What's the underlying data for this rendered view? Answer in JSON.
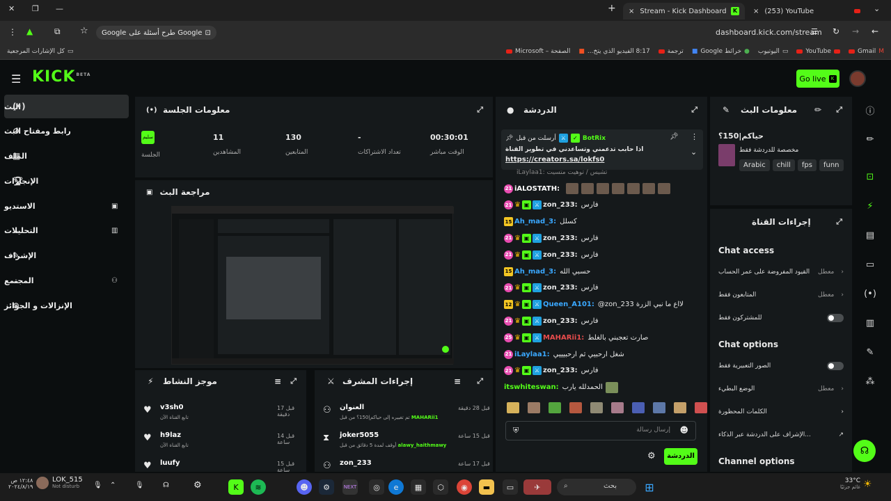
{
  "browser": {
    "tabs": [
      {
        "title": "Stream - Kick Dashboard",
        "close": "×"
      },
      {
        "title": "(253) YouTube",
        "close": "×"
      }
    ],
    "new_tab": "+",
    "url": "dashboard.kick.com/stream",
    "google_prompt": "طرح أسئلة على Google",
    "all_bookmarks": "كل الإشارات المرجعية",
    "bookmarks": [
      "Gmail",
      "YouTube",
      "اليوتيوب",
      "خرائط Google",
      "ترجمة",
      "8:17 الفيديو الذي يتخ...",
      "الصفحة – Microsoft"
    ]
  },
  "header": {
    "logo": "KICK",
    "beta": "BETA",
    "go_live": "Go live"
  },
  "nav": [
    {
      "label": "البث"
    },
    {
      "label": "رابط ومفتاح البث"
    },
    {
      "label": "الملف"
    },
    {
      "label": "الإنجازات"
    },
    {
      "label": "الاستديو"
    },
    {
      "label": "التحليلات"
    },
    {
      "label": "الإشراف"
    },
    {
      "label": "المجتمع"
    },
    {
      "label": "الإنزالات و الجوائز"
    }
  ],
  "session": {
    "title": "معلومات الجلسة",
    "badge": "سليم",
    "badge_label": "الجلسة",
    "stats": [
      {
        "value": "11",
        "label": "المشاهدين"
      },
      {
        "value": "130",
        "label": "المتابعين"
      },
      {
        "value": "-",
        "label": "تعداد الاشتراكات"
      },
      {
        "value": "00:30:01",
        "label": "الوقت مباشر"
      }
    ]
  },
  "preview": {
    "title": "مراجعة البث"
  },
  "activity": {
    "title": "موجز النشاط",
    "items": [
      {
        "name": "v3sh0",
        "sub": "تابع القناة الآن",
        "time": "قبل 17 دقيقة"
      },
      {
        "name": "h9laz",
        "sub": "تابع القناة الآن",
        "time": "قبل 14 ساعة"
      },
      {
        "name": "luufy",
        "sub": "",
        "time": "قبل 15 ساعة"
      }
    ]
  },
  "modlog": {
    "title": "إجراءات المشرف",
    "items": [
      {
        "name": "العنوان",
        "sub": "تم تغييره إلى حياكم|150؟ من قبل",
        "actor": "MAHARii1",
        "time": "قبل 28 دقيقة"
      },
      {
        "name": "joker5055",
        "sub": "أوقف لمدة 5 دقائق من قبل",
        "actor": "alawy_haithmawy",
        "time": "قبل 15 ساعة"
      },
      {
        "name": "zon_233",
        "sub": "",
        "actor": "",
        "time": "قبل 17 ساعة"
      }
    ]
  },
  "chat": {
    "title": "الدردشة",
    "pinned": {
      "by_label": "أرسلت من قبل",
      "by": "BotRix",
      "text": "اذا حابب تدعمني وتساعدني في تطوير القناة",
      "link": "https://creators.sa/lokfs0"
    },
    "partial_msg": "iLaylaa1: تشيس / توهيت متسيت",
    "messages": [
      {
        "lvl": "21",
        "user": "iALOSTATH:",
        "text": "",
        "color": "#ffffff",
        "emotes": true
      },
      {
        "lvl": "21",
        "user": "zon_233:",
        "text": "فارس",
        "color": "#e8e8e8",
        "badges": true
      },
      {
        "lvl": "15",
        "user": "Ah_mad_3:",
        "text": "كسلل",
        "color": "#3aa8ff",
        "y": true
      },
      {
        "lvl": "21",
        "user": "zon_233:",
        "text": "فارس",
        "color": "#e8e8e8",
        "badges": true
      },
      {
        "lvl": "21",
        "user": "zon_233:",
        "text": "فارس",
        "color": "#e8e8e8",
        "badges": true
      },
      {
        "lvl": "15",
        "user": "Ah_mad_3:",
        "text": "حسبي الله",
        "color": "#3aa8ff",
        "y": true
      },
      {
        "lvl": "21",
        "user": "zon_233:",
        "text": "فارس",
        "color": "#e8e8e8",
        "badges": true
      },
      {
        "lvl": "12",
        "user": "Queen_A101:",
        "text": "@zon_233 لااع ما نبي الزرة",
        "color": "#3aa8ff",
        "y": true,
        "badges": true
      },
      {
        "lvl": "21",
        "user": "zon_233:",
        "text": "فارس",
        "color": "#e8e8e8",
        "badges": true
      },
      {
        "lvl": "25",
        "user": "MAHARii1:",
        "text": "صارت تعجبني بالغلط",
        "color": "#e84c4c",
        "badges": true
      },
      {
        "lvl": "21",
        "user": "iLaylaa1:",
        "text": "شغل ارحبيي ثم ارحبيييي",
        "color": "#3aa8ff"
      },
      {
        "lvl": "21",
        "user": "zon_233:",
        "text": "فارس",
        "color": "#e8e8e8",
        "badges": true
      },
      {
        "lvl": "",
        "user": "itswhiteswan:",
        "text": "الحمدلله يارب",
        "color": "#53fc18"
      }
    ],
    "placeholder": "إرسال رسالة",
    "send": "الدردشة"
  },
  "stream_info": {
    "title": "معلومات البث",
    "stream_title": "حياكم|150؟",
    "category": "مخصصة للدردشة فقط",
    "tags": [
      "Arabic",
      "chill",
      "fps",
      "funn"
    ]
  },
  "channel_actions": {
    "title": "إجراءات القناة",
    "chat_access": "Chat access",
    "access_rows": [
      {
        "label": "القيود المفروضة على عمر الحساب",
        "value": "معطل"
      },
      {
        "label": "المتابعون فقط",
        "value": "معطل"
      },
      {
        "label": "للمشتركون فقط",
        "value": ""
      }
    ],
    "chat_options": "Chat options",
    "option_rows": [
      {
        "label": "الصور التعبيرية فقط",
        "value": ""
      },
      {
        "label": "الوضع البطيء",
        "value": "معطل"
      },
      {
        "label": "الكلمات المحظورة",
        "value": ""
      },
      {
        "label": "الإشراف على الدردشة عبر الذكاء...",
        "value": ""
      }
    ],
    "channel_options": "Channel options"
  },
  "taskbar": {
    "user": "LOK_515",
    "status": "Not disturb",
    "time": "١٢:٤٨ ص",
    "date": "٢٠٢٤/٨/١٩",
    "search": "بحث",
    "weather_temp": "33°C",
    "weather_desc": "غائم جزئيًا"
  }
}
